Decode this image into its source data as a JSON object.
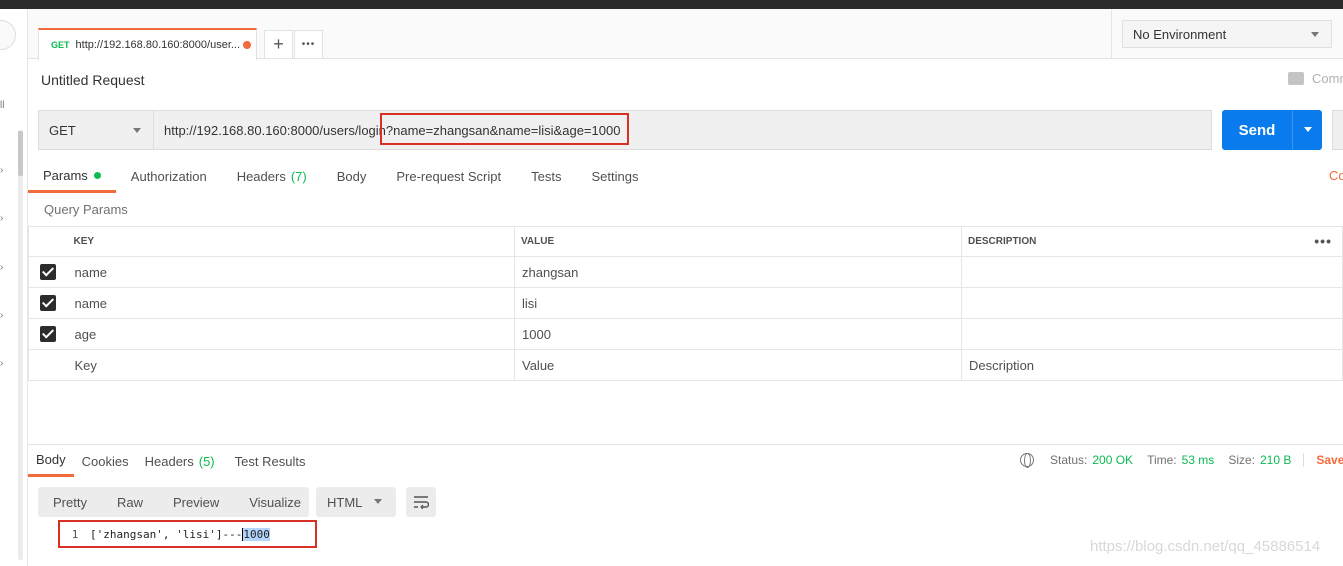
{
  "tabs": [
    {
      "method": "GET",
      "url": "http://192.168.80.160:8000/user..."
    }
  ],
  "tab_actions": {
    "add": "+",
    "more": "•••"
  },
  "environment": {
    "selected": "No Environment"
  },
  "request": {
    "title": "Untitled Request",
    "comments_label": "Comm",
    "method": "GET",
    "url": "http://192.168.80.160:8000/users/login?name=zhangsan&name=lisi&age=1000",
    "send_label": "Send"
  },
  "request_tabs": [
    {
      "label": "Params",
      "badge": ""
    },
    {
      "label": "Authorization",
      "badge": ""
    },
    {
      "label": "Headers",
      "badge": "(7)"
    },
    {
      "label": "Body",
      "badge": ""
    },
    {
      "label": "Pre-request Script",
      "badge": ""
    },
    {
      "label": "Tests",
      "badge": ""
    },
    {
      "label": "Settings",
      "badge": ""
    }
  ],
  "cookies_link": "Co",
  "query_params": {
    "label": "Query Params",
    "columns": [
      "KEY",
      "VALUE",
      "DESCRIPTION"
    ],
    "more": "•••",
    "rows": [
      {
        "checked": true,
        "key": "name",
        "value": "zhangsan",
        "description": ""
      },
      {
        "checked": true,
        "key": "name",
        "value": "lisi",
        "description": ""
      },
      {
        "checked": true,
        "key": "age",
        "value": "1000",
        "description": ""
      }
    ],
    "placeholders": {
      "key": "Key",
      "value": "Value",
      "description": "Description"
    }
  },
  "response": {
    "tabs": [
      {
        "label": "Body",
        "badge": ""
      },
      {
        "label": "Cookies",
        "badge": ""
      },
      {
        "label": "Headers",
        "badge": "(5)"
      },
      {
        "label": "Test Results",
        "badge": ""
      }
    ],
    "status_label": "Status:",
    "status": "200 OK",
    "time_label": "Time:",
    "time": "53 ms",
    "size_label": "Size:",
    "size": "210 B",
    "save_label": "Save R",
    "view_modes": [
      "Pretty",
      "Raw",
      "Preview",
      "Visualize"
    ],
    "format": "HTML",
    "body_line_no": "1",
    "body_text": "['zhangsan', 'lisi']---",
    "body_selected": "1000"
  },
  "watermark": "https://blog.csdn.net/qq_45886514",
  "colors": {
    "accent": "#f26b3a",
    "send": "#097bed",
    "success": "#0cbb52",
    "highlight_box": "#d93025"
  }
}
